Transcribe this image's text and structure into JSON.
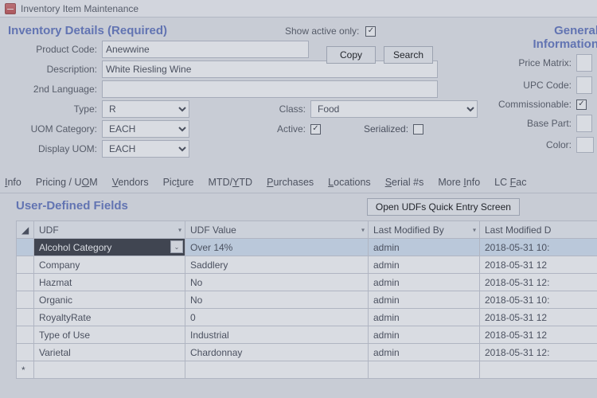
{
  "window": {
    "title": "Inventory Item Maintenance"
  },
  "sections": {
    "inventory_title": "Inventory Details (Required)",
    "general_title": "General Information",
    "udf_title": "User-Defined Fields"
  },
  "show_active": {
    "label": "Show active only:",
    "checked": true
  },
  "labels": {
    "product_code": "Product Code:",
    "description": "Description:",
    "second_lang": "2nd Language:",
    "type": "Type:",
    "class": "Class:",
    "uom_category": "UOM Category:",
    "active": "Active:",
    "serialized": "Serialized:",
    "display_uom": "Display UOM:",
    "price_matrix": "Price Matrix:",
    "upc_code": "UPC Code:",
    "commissionable": "Commissionable:",
    "base_part": "Base Part:",
    "color": "Color:"
  },
  "values": {
    "product_code": "Anewwine",
    "description": "White Riesling Wine",
    "second_lang": "",
    "type": "R",
    "class": "Food",
    "uom_category": "EACH",
    "active": true,
    "serialized": false,
    "display_uom": "EACH",
    "commissionable": true
  },
  "buttons": {
    "copy": "Copy",
    "search": "Search",
    "open_udf": "Open UDFs Quick Entry Screen"
  },
  "tabs": [
    "Info",
    "Pricing / UOM",
    "Vendors",
    "Picture",
    "MTD/YTD",
    "Purchases",
    "Locations",
    "Serial #s",
    "More Info",
    "LC Fac"
  ],
  "tab_accelerators": [
    "I",
    "O",
    "V",
    "t",
    "Y",
    "P",
    "L",
    "S",
    "I",
    "F"
  ],
  "udf_table": {
    "headers": [
      "UDF",
      "UDF Value",
      "Last Modified By",
      "Last Modified D"
    ],
    "rows": [
      {
        "udf": "Alcohol Category",
        "value": "Over 14%",
        "by": "admin",
        "dt": "2018-05-31 10:",
        "selected": true
      },
      {
        "udf": "Company",
        "value": "Saddlery",
        "by": "admin",
        "dt": "2018-05-31 12"
      },
      {
        "udf": "Hazmat",
        "value": "No",
        "by": "admin",
        "dt": "2018-05-31 12:"
      },
      {
        "udf": "Organic",
        "value": "No",
        "by": "admin",
        "dt": "2018-05-31 10:"
      },
      {
        "udf": "RoyaltyRate",
        "value": "0",
        "by": "admin",
        "dt": "2018-05-31 12"
      },
      {
        "udf": "Type of Use",
        "value": "Industrial",
        "by": "admin",
        "dt": "2018-05-31 12"
      },
      {
        "udf": "Varietal",
        "value": "Chardonnay",
        "by": "admin",
        "dt": "2018-05-31 12:"
      }
    ]
  }
}
